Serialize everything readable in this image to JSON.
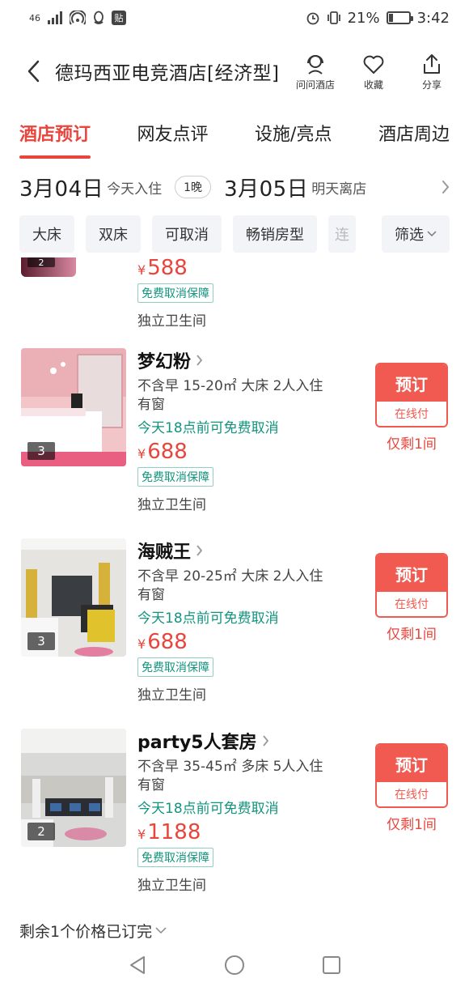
{
  "status_bar": {
    "network": "46",
    "battery_percent": "21%",
    "time": "3:42",
    "notification_badge": "贴",
    "battery_level": 0.21
  },
  "header": {
    "hotel_name": "德玛西亚电竞酒店[经济型]",
    "actions": [
      {
        "label": "问问酒店",
        "icon": "ask-hotel-icon"
      },
      {
        "label": "收藏",
        "icon": "heart-icon"
      },
      {
        "label": "分享",
        "icon": "share-icon"
      }
    ]
  },
  "tabs": [
    {
      "label": "酒店预订",
      "active": true
    },
    {
      "label": "网友点评",
      "active": false
    },
    {
      "label": "设施/亮点",
      "active": false
    },
    {
      "label": "酒店周边",
      "active": false
    }
  ],
  "date_bar": {
    "checkin_date": "3月04日",
    "checkin_note": "今天入住",
    "nights": "1晚",
    "checkout_date": "3月05日",
    "checkout_note": "明天离店"
  },
  "filters": [
    "大床",
    "双床",
    "可取消",
    "畅销房型",
    "连",
    "筛选"
  ],
  "partial_room": {
    "photo_count": "2",
    "price": "588",
    "currency": "¥",
    "guarantee": "免费取消保障",
    "bathroom": "独立卫生间"
  },
  "rooms": [
    {
      "name": "梦幻粉",
      "desc_line1": "不含早 15-20㎡ 大床 2人入住",
      "desc_line2": "有窗",
      "cancel": "今天18点前可免费取消",
      "currency": "¥",
      "price": "688",
      "guarantee": "免费取消保障",
      "bathroom": "独立卫生间",
      "photo_count": "3",
      "book_label": "预订",
      "pay_label": "在线付",
      "remaining": "仅剩1间"
    },
    {
      "name": "海贼王",
      "desc_line1": "不含早 20-25㎡ 大床 2人入住",
      "desc_line2": "有窗",
      "cancel": "今天18点前可免费取消",
      "currency": "¥",
      "price": "688",
      "guarantee": "免费取消保障",
      "bathroom": "独立卫生间",
      "photo_count": "3",
      "book_label": "预订",
      "pay_label": "在线付",
      "remaining": "仅剩1间"
    },
    {
      "name": "party5人套房",
      "desc_line1": "不含早 35-45㎡ 多床 5人入住",
      "desc_line2": "有窗",
      "cancel": "今天18点前可免费取消",
      "currency": "¥",
      "price": "1188",
      "guarantee": "免费取消保障",
      "bathroom": "独立卫生间",
      "photo_count": "2",
      "book_label": "预订",
      "pay_label": "在线付",
      "remaining": "仅剩1间"
    }
  ],
  "footer_note": "剩余1个价格已订完",
  "colors": {
    "accent": "#e8453c",
    "teal": "#12947e",
    "chip_bg": "#f3f4f7"
  }
}
